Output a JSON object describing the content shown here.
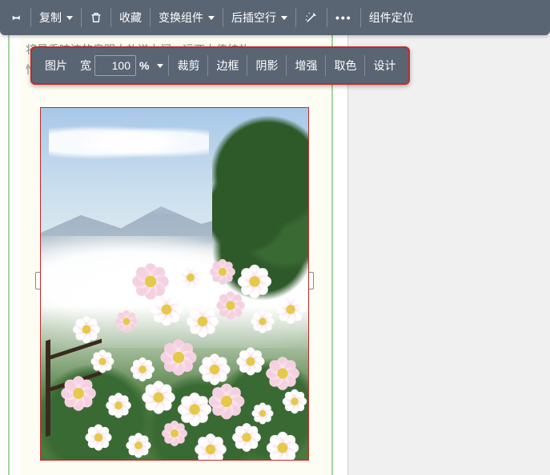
{
  "main_toolbar": {
    "copy": "复制",
    "favorite": "收藏",
    "transform_component": "变换组件",
    "insert_blank_after": "后插空行",
    "component_locate": "组件定位"
  },
  "doc": {
    "line1": "将最香味浓的奥明大礼送上门，远西上传统礼",
    "line2": "恰维中国自古代的广至宇宁城"
  },
  "image_toolbar": {
    "label": "图片",
    "width_label": "宽",
    "width_value": "100",
    "unit": "%",
    "crop": "裁剪",
    "border": "边框",
    "shadow": "阴影",
    "enhance": "增强",
    "pick_color": "取色",
    "design": "设计"
  }
}
